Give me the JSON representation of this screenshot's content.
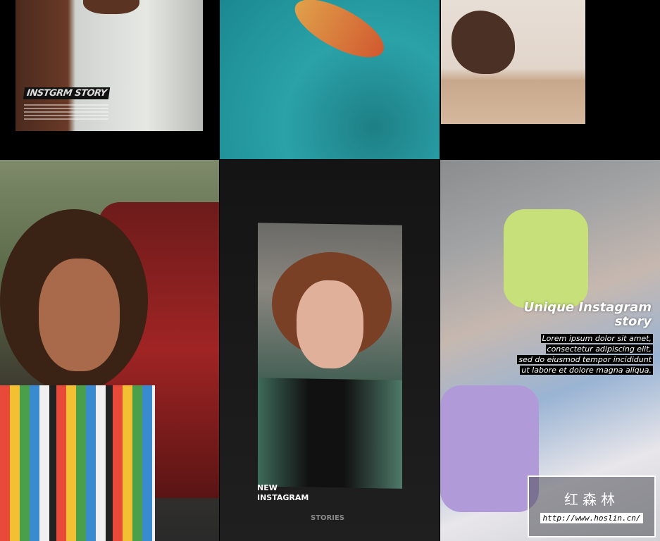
{
  "panels": {
    "top_left": {
      "tag": "INSTGRM STORY"
    },
    "bottom_middle": {
      "headline": "NEW\nINSTAGRAM",
      "sub": "STORIES"
    },
    "bottom_right": {
      "title": "Unique Instagram story",
      "body_lines": [
        "Lorem ipsum dolor sit amet,",
        "consectetur adipiscing elit,",
        "sed do eiusmod tempor incididunt",
        "ut labore et dolore magna aliqua."
      ]
    }
  },
  "watermark": {
    "name": "红森林",
    "url": "http://www.hoslin.cn/"
  }
}
